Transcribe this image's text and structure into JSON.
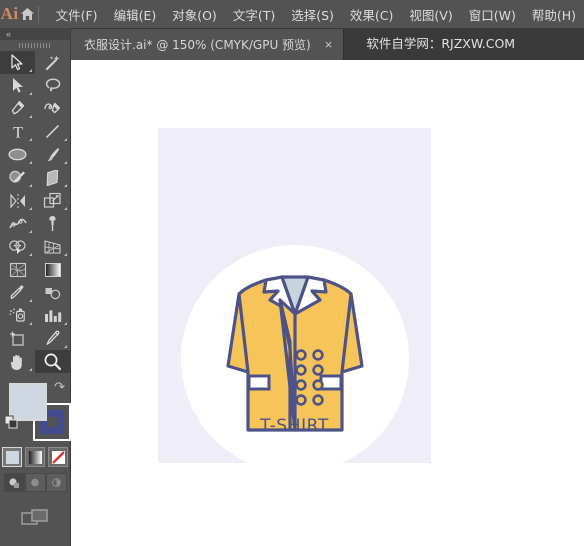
{
  "app": {
    "logo_text": "Ai",
    "home_icon": "home-icon"
  },
  "menubar": {
    "items": [
      {
        "label": "文件(F)",
        "name": "menu-file"
      },
      {
        "label": "编辑(E)",
        "name": "menu-edit"
      },
      {
        "label": "对象(O)",
        "name": "menu-object"
      },
      {
        "label": "文字(T)",
        "name": "menu-type"
      },
      {
        "label": "选择(S)",
        "name": "menu-select"
      },
      {
        "label": "效果(C)",
        "name": "menu-effect"
      },
      {
        "label": "视图(V)",
        "name": "menu-view"
      },
      {
        "label": "窗口(W)",
        "name": "menu-window"
      },
      {
        "label": "帮助(H)",
        "name": "menu-help"
      }
    ]
  },
  "tabbar": {
    "document_tab": "衣服设计.ai* @ 150% (CMYK/GPU 预览)",
    "close_glyph": "×",
    "extra_label": "软件自学网：RJZXW.COM"
  },
  "toolpanel": {
    "collapse_glyph": "«",
    "tools": [
      {
        "name": "selection-tool",
        "selected": true,
        "flyout": true
      },
      {
        "name": "magic-wand-tool",
        "selected": false,
        "flyout": false
      },
      {
        "name": "direct-selection-tool",
        "selected": false,
        "flyout": true
      },
      {
        "name": "lasso-tool",
        "selected": false,
        "flyout": false
      },
      {
        "name": "pen-tool",
        "selected": false,
        "flyout": true
      },
      {
        "name": "curvature-tool",
        "selected": false,
        "flyout": false
      },
      {
        "name": "type-tool",
        "selected": false,
        "flyout": true
      },
      {
        "name": "line-segment-tool",
        "selected": false,
        "flyout": true
      },
      {
        "name": "ellipse-tool",
        "selected": false,
        "flyout": true
      },
      {
        "name": "paintbrush-tool",
        "selected": false,
        "flyout": true
      },
      {
        "name": "shaper-tool",
        "selected": false,
        "flyout": true
      },
      {
        "name": "eraser-tool",
        "selected": false,
        "flyout": true
      },
      {
        "name": "rotate-reflect-tool",
        "selected": false,
        "flyout": true
      },
      {
        "name": "scale-tool",
        "selected": false,
        "flyout": true
      },
      {
        "name": "width-tool",
        "selected": false,
        "flyout": true
      },
      {
        "name": "free-transform-tool",
        "selected": false,
        "flyout": false
      },
      {
        "name": "shape-builder-tool",
        "selected": false,
        "flyout": true
      },
      {
        "name": "perspective-grid-tool",
        "selected": false,
        "flyout": true
      },
      {
        "name": "mesh-tool",
        "selected": false,
        "flyout": false
      },
      {
        "name": "gradient-tool",
        "selected": false,
        "flyout": false
      },
      {
        "name": "eyedropper-tool",
        "selected": false,
        "flyout": true
      },
      {
        "name": "blend-tool",
        "selected": false,
        "flyout": false
      },
      {
        "name": "symbol-sprayer-tool",
        "selected": false,
        "flyout": true
      },
      {
        "name": "column-graph-tool",
        "selected": false,
        "flyout": true
      },
      {
        "name": "artboard-tool",
        "selected": false,
        "flyout": false
      },
      {
        "name": "slice-tool",
        "selected": false,
        "flyout": true
      },
      {
        "name": "hand-tool",
        "selected": false,
        "flyout": true
      },
      {
        "name": "zoom-tool",
        "selected": true,
        "flyout": false
      }
    ],
    "swatches": {
      "fill_color": "#CFD8E2",
      "stroke_color": "#434B8C",
      "swap_icon": "swap-fill-stroke-icon",
      "default_icon": "default-fill-stroke-icon"
    },
    "color_modes": [
      {
        "name": "solid-color-mode",
        "on": true
      },
      {
        "name": "gradient-color-mode",
        "on": false
      },
      {
        "name": "none-color-mode",
        "on": false
      }
    ],
    "draw_modes": [
      {
        "name": "draw-normal-mode",
        "on": true
      },
      {
        "name": "draw-behind-mode",
        "on": false
      },
      {
        "name": "draw-inside-mode",
        "on": false
      }
    ],
    "screen_mode": {
      "name": "change-screen-mode-button"
    }
  },
  "canvas": {
    "artboard": {
      "background": "#EEEDF8",
      "circle_color": "#FFFFFF",
      "label": "T-SHIRT",
      "label_color": "#4E5387"
    },
    "artwork": {
      "name": "coat-illustration",
      "body_color": "#F6C459",
      "outline_color": "#4E5387",
      "lapel_color": "#FFFFFF",
      "collar_inner_color": "#C7D4DE",
      "pocket_color": "#FFFFFF",
      "button_count": 8
    }
  }
}
